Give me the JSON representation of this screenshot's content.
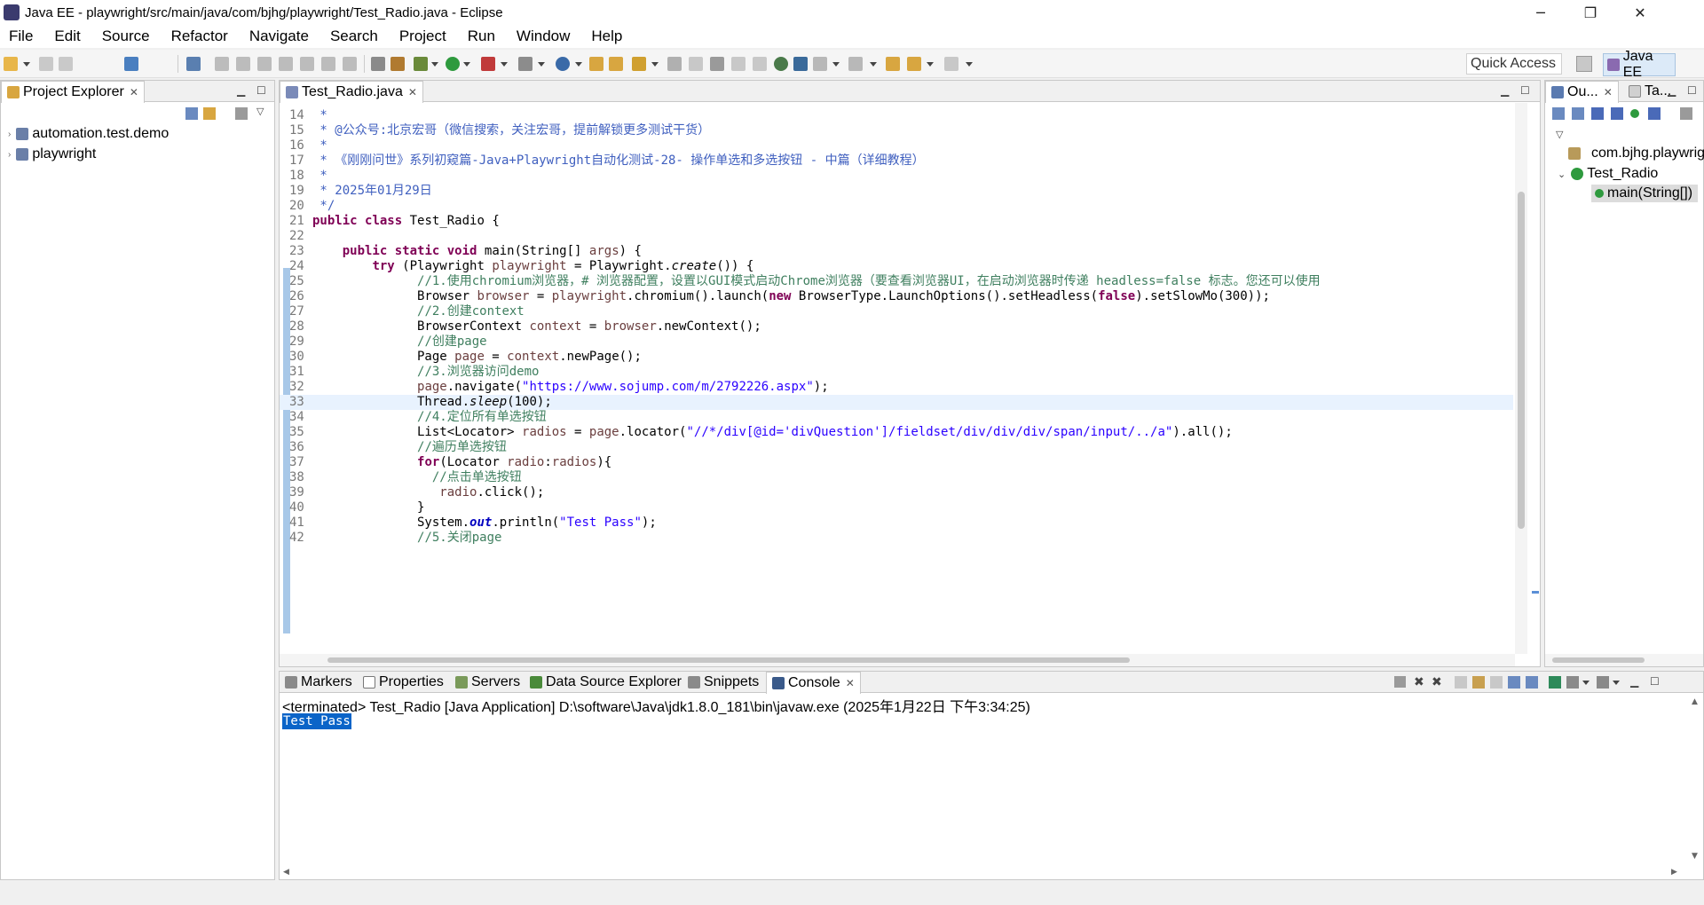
{
  "window": {
    "title": "Java EE - playwright/src/main/java/com/bjhg/playwright/Test_Radio.java - Eclipse",
    "minimize": "─",
    "restore": "❐",
    "close": "✕"
  },
  "menu": [
    "File",
    "Edit",
    "Source",
    "Refactor",
    "Navigate",
    "Search",
    "Project",
    "Run",
    "Window",
    "Help"
  ],
  "toolbar": {
    "quick_access": "Quick Access",
    "perspective": "Java EE"
  },
  "project_explorer": {
    "tab_label": "Project Explorer",
    "items": [
      {
        "label": "automation.test.demo"
      },
      {
        "label": "playwright"
      }
    ]
  },
  "editor": {
    "tab_label": "Test_Radio.java",
    "current_line": 33,
    "lines": [
      {
        "n": "14",
        "html": "<span class='jd'> *</span>"
      },
      {
        "n": "15",
        "html": "<span class='jd'> * @公众号:北京宏哥（微信搜索，关注宏哥，提前解锁更多测试干货）</span>"
      },
      {
        "n": "16",
        "html": "<span class='jd'> *</span>"
      },
      {
        "n": "17",
        "html": "<span class='jd'> * 《刚刚问世》系列初窥篇-Java+Playwright自动化测试-28- 操作单选和多选按钮 - 中篇（详细教程）</span>"
      },
      {
        "n": "18",
        "html": "<span class='jd'> *</span>"
      },
      {
        "n": "19",
        "html": "<span class='jd'> * 2025年01月29日</span>"
      },
      {
        "n": "20",
        "html": "<span class='jd'> */</span>"
      },
      {
        "n": "21",
        "html": "<span class='kw'>public</span> <span class='kw'>class</span> Test_Radio {"
      },
      {
        "n": "22",
        "html": ""
      },
      {
        "n": "23",
        "html": "    <span class='kw'>public</span> <span class='kw'>static</span> <span class='kw'>void</span> main(String[] <span class='var'>args</span>) {"
      },
      {
        "n": "24",
        "html": "        <span class='kw'>try</span> (Playwright <span class='var'>playwright</span> = Playwright.<span class='it'>create</span>()) {"
      },
      {
        "n": "25",
        "html": "              <span class='cm'>//1.使用chromium浏览器，# 浏览器配置，设置以GUI模式启动Chrome浏览器（要查看浏览器UI，在启动浏览器时传递 headless=false 标志。您还可以使用</span>"
      },
      {
        "n": "26",
        "html": "              Browser <span class='var'>browser</span> = <span class='var'>playwright</span>.chromium().launch(<span class='kw'>new</span> BrowserType.LaunchOptions().setHeadless(<span class='kw'>false</span>).setSlowMo(300));"
      },
      {
        "n": "27",
        "html": "              <span class='cm'>//2.创建context</span>"
      },
      {
        "n": "28",
        "html": "              BrowserContext <span class='var'>context</span> = <span class='var'>browser</span>.newContext();"
      },
      {
        "n": "29",
        "html": "              <span class='cm'>//创建page</span>"
      },
      {
        "n": "30",
        "html": "              Page <span class='var'>page</span> = <span class='var'>context</span>.newPage();"
      },
      {
        "n": "31",
        "html": "              <span class='cm'>//3.浏览器访问demo</span>"
      },
      {
        "n": "32",
        "html": "              <span class='var'>page</span>.navigate(<span class='str'>\"https://www.sojump.com/m/2792226.aspx\"</span>);"
      },
      {
        "n": "33",
        "html": "              Thread.<span class='it'>sleep</span>(100);"
      },
      {
        "n": "34",
        "html": "              <span class='cm'>//4.定位所有单选按钮</span>"
      },
      {
        "n": "35",
        "html": "              List&lt;Locator&gt; <span class='var'>radios</span> = <span class='var'>page</span>.locator(<span class='str'>\"//*/div[@id='divQuestion']/fieldset/div/div/div/span/input/../a\"</span>).all();"
      },
      {
        "n": "36",
        "html": "              <span class='cm'>//遍历单选按钮</span>"
      },
      {
        "n": "37",
        "html": "              <span class='kw'>for</span>(Locator <span class='var'>radio</span>:<span class='var'>radios</span>){"
      },
      {
        "n": "38",
        "html": "                <span class='cm'>//点击单选按钮</span>"
      },
      {
        "n": "39",
        "html": "                 <span class='var'>radio</span>.click();"
      },
      {
        "n": "40",
        "html": "              }"
      },
      {
        "n": "41",
        "html": "              System.<span class='fld'>out</span>.println(<span class='str'>\"Test Pass\"</span>);"
      },
      {
        "n": "42",
        "html": "              <span class='cm'>//5.关闭page</span>"
      }
    ]
  },
  "outline": {
    "tab_outline": "Ou...",
    "tab_task": "Ta...",
    "items": [
      {
        "label": "com.bjhg.playwright"
      },
      {
        "label": "Test_Radio"
      },
      {
        "label": "main(String[])"
      }
    ]
  },
  "bottom_tabs": [
    "Markers",
    "Properties",
    "Servers",
    "Data Source Explorer",
    "Snippets",
    "Console"
  ],
  "console": {
    "header": "<terminated> Test_Radio [Java Application] D:\\software\\Java\\jdk1.8.0_181\\bin\\javaw.exe (2025年1月22日 下午3:34:25)",
    "output": "Test Pass"
  },
  "colors": {
    "selection": "#0a64c8",
    "line_highlight": "#e8f2fe",
    "perspective_bg": "#dceaf8"
  }
}
